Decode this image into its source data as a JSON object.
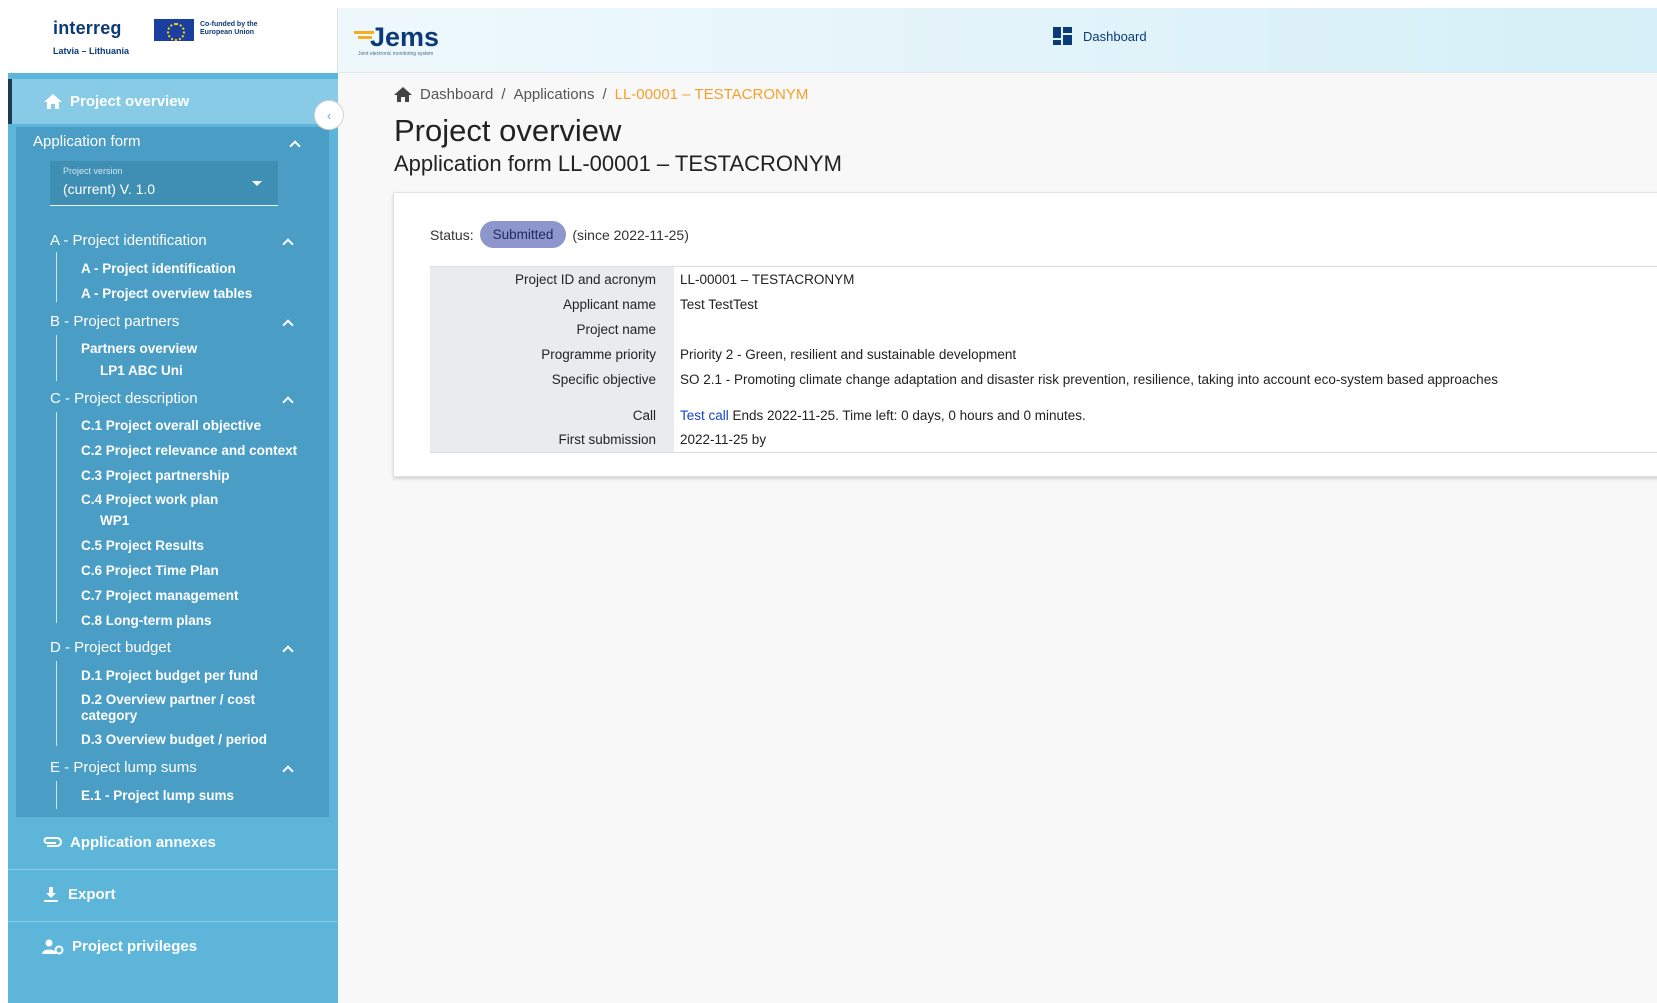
{
  "header": {
    "brand": "interreg",
    "cofund_text": "Co-funded by the European Union",
    "region": "Latvia – Lithuania",
    "app_name": "Jems",
    "app_subtitle": "Joint electronic monitoring system",
    "dashboard_label": "Dashboard"
  },
  "sidebar": {
    "overview_label": "Project overview",
    "collapse_glyph": "‹",
    "application_form_label": "Application form",
    "version": {
      "label": "Project version",
      "value": "(current) V. 1.0"
    },
    "sections": [
      {
        "title": "A - Project identification",
        "items": [
          "A - Project identification",
          "A - Project overview tables"
        ]
      },
      {
        "title": "B - Project partners",
        "items": [
          "Partners overview"
        ],
        "sub_items": [
          "LP1 ABC Uni"
        ]
      },
      {
        "title": "C - Project description",
        "items": [
          "C.1 Project overall objective",
          "C.2 Project relevance and context",
          "C.3 Project partnership",
          "C.4 Project work plan",
          "C.5 Project Results",
          "C.6 Project Time Plan",
          "C.7 Project management",
          "C.8 Long-term plans"
        ],
        "sub_items": [
          "WP1"
        ]
      },
      {
        "title": "D - Project budget",
        "items": [
          "D.1 Project budget per fund",
          "D.2 Overview partner / cost category",
          "D.3 Overview budget / period"
        ]
      },
      {
        "title": "E - Project lump sums",
        "items": [
          "E.1 - Project lump sums"
        ]
      }
    ],
    "annexes_label": "Application annexes",
    "export_label": "Export",
    "privileges_label": "Project privileges"
  },
  "main": {
    "breadcrumb": [
      "Dashboard",
      "Applications",
      "LL-00001 – TESTACRONYM"
    ],
    "title": "Project overview",
    "subtitle": "Application form LL-00001 – TESTACRONYM",
    "status_label": "Status:",
    "status_value": "Submitted",
    "status_since": "(since 2022-11-25)",
    "rows": [
      {
        "label": "Project ID and acronym",
        "value": "LL-00001 – TESTACRONYM"
      },
      {
        "label": "Applicant name",
        "value": "Test TestTest"
      },
      {
        "label": "Project name",
        "value": ""
      },
      {
        "label": "Programme priority",
        "value": "Priority 2 - Green, resilient and sustainable development"
      },
      {
        "label": "Specific objective",
        "value": "SO 2.1 - Promoting climate change adaptation and disaster risk prevention, resilience, taking into account eco-system based approaches"
      },
      {
        "label": "Call",
        "link": "Test call",
        "value": " Ends 2022-11-25. Time left: 0 days, 0 hours and 0 minutes."
      },
      {
        "label": "First submission",
        "value": "2022-11-25 by"
      }
    ]
  },
  "colors": {
    "sidebar": "#5eb5da",
    "sidebar_dark": "#4a9ec5",
    "accent": "#f2a22a",
    "brand": "#0b3a78",
    "badge": "#8e97cc"
  }
}
